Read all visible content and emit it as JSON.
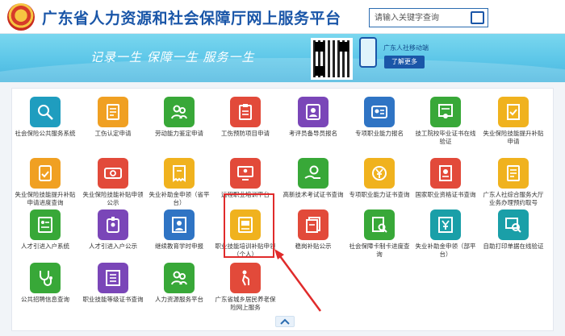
{
  "header": {
    "site_title": "广东省人力资源和社会保障厅网上服务平台",
    "search_placeholder": "请输入关键字查询"
  },
  "banner": {
    "slogan": "记录一生   保障一生   服务一生",
    "mobile_label": "广东人社移动端",
    "more_label": "了解更多"
  },
  "colors": {
    "accent": "#1a56a8",
    "banner": "#5cc6e8",
    "highlight": "#e02b2b"
  },
  "services": [
    {
      "label": "社会保险公共服务系统",
      "icon": "search-person-icon",
      "color": "#1f9dbf"
    },
    {
      "label": "工伤认定申请",
      "icon": "document-list-icon",
      "color": "#f0a022"
    },
    {
      "label": "劳动能力鉴定申请",
      "icon": "people-icon",
      "color": "#38a838"
    },
    {
      "label": "工伤预防项目申请",
      "icon": "clipboard-icon",
      "color": "#e24a3a"
    },
    {
      "label": "考评员备导员报名",
      "icon": "id-card-icon",
      "color": "#7a46b8"
    },
    {
      "label": "专项职业能力报名",
      "icon": "profile-card-icon",
      "color": "#2f74c4"
    },
    {
      "label": "技工院校毕业证书在线验证",
      "icon": "certificate-icon",
      "color": "#38a838"
    },
    {
      "label": "失业保险技能提升补贴申请",
      "icon": "document-check-icon",
      "color": "#f0b21e"
    },
    {
      "label": "失业保险技能提升补贴申请进度查询",
      "icon": "tablet-check-icon",
      "color": "#f0a022"
    },
    {
      "label": "失业保险技能补贴申领公示",
      "icon": "money-card-icon",
      "color": "#e24a3a"
    },
    {
      "label": "失业补助金申领（省平台）",
      "icon": "receipt-icon",
      "color": "#f0b21e"
    },
    {
      "label": "远程职业培训平台",
      "icon": "monitor-person-icon",
      "color": "#e24a3a"
    },
    {
      "label": "高新技术考试证书查询",
      "icon": "hand-coin-icon",
      "color": "#38a838"
    },
    {
      "label": "专项职业能力证书查询",
      "icon": "yuan-coin-icon",
      "color": "#f0b21e"
    },
    {
      "label": "国家职业资格证书查询",
      "icon": "certificate-doc-icon",
      "color": "#e24a3a"
    },
    {
      "label": "广东人社综合服务大厅业务办理预约取号",
      "icon": "document-list-icon",
      "color": "#f0b21e"
    },
    {
      "label": "人才引进入户系统",
      "icon": "form-icon",
      "color": "#38a838"
    },
    {
      "label": "人才引进入户公示",
      "icon": "badge-icon",
      "color": "#7a46b8"
    },
    {
      "label": "继续教育学时申报",
      "icon": "person-doc-icon",
      "color": "#2f74c4"
    },
    {
      "label": "职业技能培训补贴申领（个人）",
      "icon": "card-edit-icon",
      "color": "#f0b21e"
    },
    {
      "label": "稳岗补贴公示",
      "icon": "pages-icon",
      "color": "#e24a3a"
    },
    {
      "label": "社会保障卡制卡进度查询",
      "icon": "search-doc-icon",
      "color": "#38a838"
    },
    {
      "label": "失业补助金申领（部平台）",
      "icon": "yuan-doc-icon",
      "color": "#1a9fa8"
    },
    {
      "label": "自助打印单据在线验证",
      "icon": "stamp-search-icon",
      "color": "#1a9fa8"
    },
    {
      "label": "公共招聘信息查询",
      "icon": "stethoscope-icon",
      "color": "#38a838"
    },
    {
      "label": "职业技能等级证书查询",
      "icon": "list-doc-icon",
      "color": "#7a46b8"
    },
    {
      "label": "人力资源服务平台",
      "icon": "people-icon",
      "color": "#38a838"
    },
    {
      "label": "广东省城乡居民养老保险网上服务",
      "icon": "elderly-icon",
      "color": "#e24a3a"
    }
  ]
}
